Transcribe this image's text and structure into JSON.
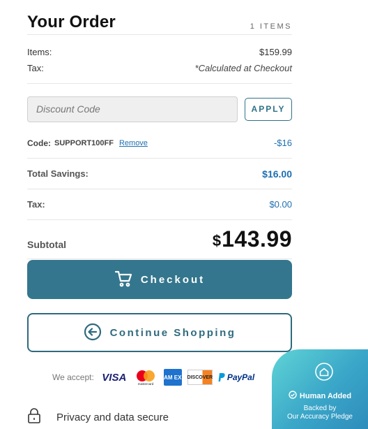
{
  "order": {
    "title": "Your Order",
    "items_count": "1 ITEMS",
    "items_label": "Items:",
    "items_value": "$159.99",
    "tax_label": "Tax:",
    "tax_value": "*Calculated at Checkout"
  },
  "discount": {
    "placeholder": "Discount Code",
    "value": "",
    "apply_label": "APPLY"
  },
  "code": {
    "label": "Code:",
    "value": "SUPPORT100FF",
    "remove_label": "Remove",
    "amount": "-$16"
  },
  "totals": {
    "savings_label": "Total Savings:",
    "savings_value": "$16.00",
    "tax_label": "Tax:",
    "tax_value": "$0.00",
    "subtotal_label": "Subtotal",
    "subtotal_currency": "$",
    "subtotal_value": "143.99"
  },
  "buttons": {
    "checkout_label": "Checkout",
    "continue_label": "Continue Shopping"
  },
  "payments": {
    "accept_label": "We accept:",
    "cards": [
      "VISA",
      "mastercard",
      "AM EX",
      "DISCOVER",
      "PayPal"
    ]
  },
  "security": {
    "text": "Privacy and data secure"
  },
  "badge": {
    "title": "Human Added",
    "line1": "Backed by",
    "line2": "Our Accuracy Pledge"
  },
  "colors": {
    "accent": "#34768d",
    "link": "#1e6fb0",
    "badge_gradient_start": "#5fd4d6",
    "badge_gradient_end": "#2b86b8"
  }
}
